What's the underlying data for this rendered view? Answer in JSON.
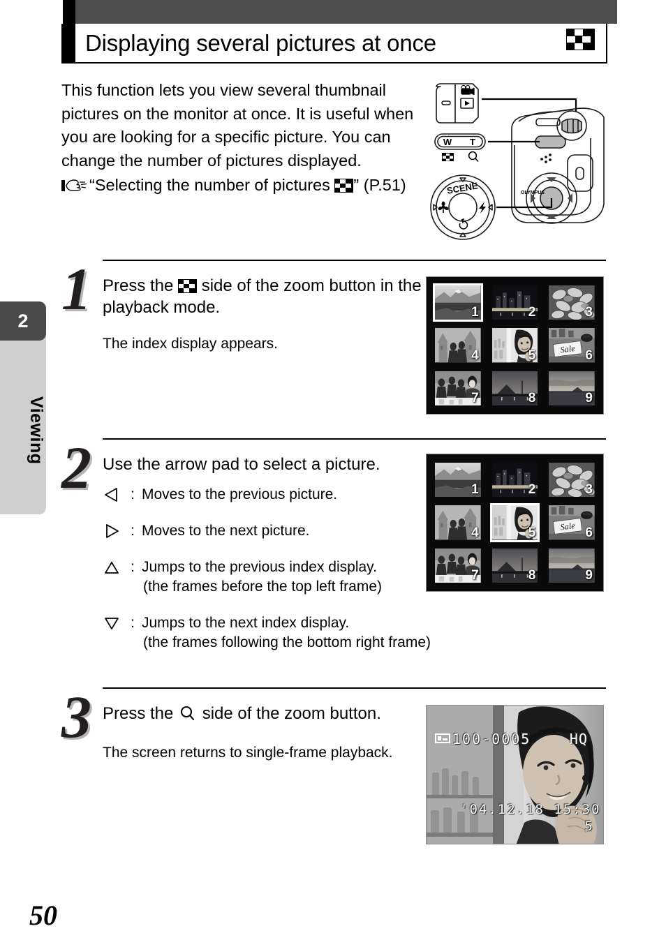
{
  "page": {
    "number": "50",
    "title": "Displaying several pictures at once",
    "title_icon": "index-display-icon"
  },
  "sidebar": {
    "chapter_number": "2",
    "chapter_label": "Viewing"
  },
  "intro": {
    "paragraph": "This function lets you view several thumbnail pictures on the monitor at once. It is useful when you are looking for a specific picture. You can change the number of pictures displayed.",
    "reference_prefix": "“Selecting the number of pictures ",
    "reference_suffix": "” (P.51)",
    "reference_icon": "index-display-icon",
    "hand_icon": "pointing-hand-icon"
  },
  "camera_diagram": {
    "mode_switch_icons": [
      "movie-mode-icon",
      "playback-mode-icon"
    ],
    "zoom_lever": {
      "wide_label": "W",
      "tele_label": "T",
      "wide_icon": "index-display-icon",
      "tele_icon": "magnifier-icon"
    },
    "arrow_pad": {
      "top_label": "SCENE",
      "left_icon": "macro-flower-icon",
      "right_icon": "flash-bolt-icon",
      "bottom_icon": "self-timer-icon"
    }
  },
  "steps": [
    {
      "number": "1",
      "heading_before": "Press the ",
      "heading_icon": "index-display-icon",
      "heading_after": " side of the zoom button in the playback mode.",
      "sub": "The index display appears.",
      "lcd": {
        "type": "index",
        "selected": 1,
        "frames": [
          "1",
          "2",
          "3",
          "4",
          "5",
          "6",
          "7",
          "8",
          "9"
        ]
      }
    },
    {
      "number": "2",
      "heading": "Use the arrow pad to select a picture.",
      "arrows": [
        {
          "icon": "arrow-left-icon",
          "colon": ":",
          "text": "Moves to the previous picture.",
          "sub": ""
        },
        {
          "icon": "arrow-right-icon",
          "colon": ":",
          "text": "Moves to the next picture.",
          "sub": ""
        },
        {
          "icon": "arrow-up-icon",
          "colon": ":",
          "text": "Jumps to the previous index display.",
          "sub": "(the frames before the top left frame)"
        },
        {
          "icon": "arrow-down-icon",
          "colon": ":",
          "text": "Jumps to the next index display.",
          "sub": "(the frames following the bottom right frame)"
        }
      ],
      "lcd": {
        "type": "index",
        "selected": 5,
        "frames": [
          "1",
          "2",
          "3",
          "4",
          "5",
          "6",
          "7",
          "8",
          "9"
        ]
      }
    },
    {
      "number": "3",
      "heading_before": "Press the ",
      "heading_icon": "magnifier-icon",
      "heading_after": " side of the zoom button.",
      "sub": "The screen returns to single-frame playback.",
      "lcd": {
        "type": "single",
        "file_number": "100-0005",
        "quality": "HQ",
        "datetime": "'04.12.18  15:30",
        "frame_number": "5",
        "card_icon": "memory-card-icon"
      }
    }
  ]
}
